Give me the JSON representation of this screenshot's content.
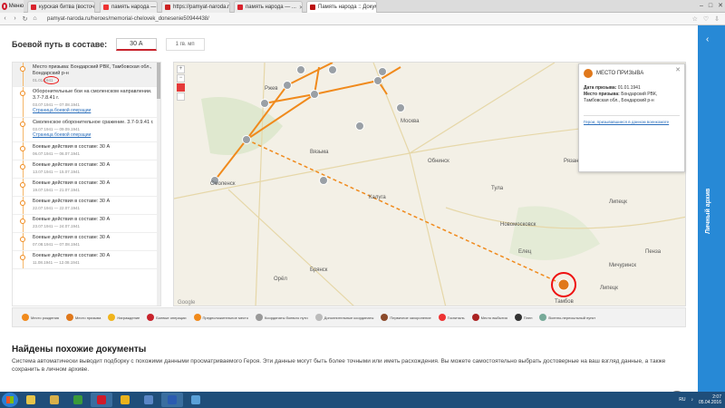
{
  "browser": {
    "menu_label": "Меню",
    "tabs": [
      {
        "label": "курская битва (восточный...",
        "color": "#d9232d"
      },
      {
        "label": "память народа — Яндекс",
        "color": "#e33"
      },
      {
        "label": "https://pamyat-naroda.ru/...",
        "color": "#cc2222"
      },
      {
        "label": "память народа — ...",
        "color": "#d9232d"
      },
      {
        "label": "Память народа :: Докум...",
        "color": "#b11",
        "active": true
      }
    ],
    "url": "pamyat-naroda.ru/heroes/memorial-chelovek_donesenie50944438/"
  },
  "page": {
    "boevoy_label": "Боевой путь в составе:",
    "army_button": "30 А",
    "guard_button": "1 гв. мп"
  },
  "timeline": [
    {
      "title": "Место призыва: Бондарский РВК, Тамбовская обл., Бондарский р-н",
      "date": "01.01.1941"
    },
    {
      "title": "Оборонительные бои на смоленском направлении. 3.7-7.8.41 г.",
      "date": "03.07.1941 — 07.08.1941",
      "link": "Страница боевой операции"
    },
    {
      "title": "Смоленское оборонительное сражение. 3.7-9.9.41 г.",
      "date": "03.07.1941 — 09.09.1941",
      "link": "Страница боевой операции"
    },
    {
      "title": "Боевые действия в составе: 30 А",
      "date": "06.07.1941 — 06.07.1941"
    },
    {
      "title": "Боевые действия в составе: 30 А",
      "date": "13.07.1941 — 15.07.1941"
    },
    {
      "title": "Боевые действия в составе: 30 А",
      "date": "19.07.1941 — 21.07.1941"
    },
    {
      "title": "Боевые действия в составе: 30 А",
      "date": "22.07.1941 — 22.07.1941"
    },
    {
      "title": "Боевые действия в составе: 30 А",
      "date": "23.07.1941 — 24.07.1941"
    },
    {
      "title": "Боевые действия в составе: 30 А",
      "date": "07.08.1941 — 07.08.1941"
    },
    {
      "title": "Боевые действия в составе: 30 А",
      "date": "11.08.1941 — 12.08.1941"
    }
  ],
  "map": {
    "cities": [
      "Москва",
      "Смоленск",
      "Калуга",
      "Тула",
      "Брянск",
      "Тамбов",
      "Рязань",
      "Ржев",
      "Вязьма",
      "Обнинск",
      "Орёл",
      "Новомосковск",
      "Мичуринск",
      "Пенза",
      "Липецк",
      "Елец",
      "Липецк"
    ],
    "attribution": "Google"
  },
  "popup": {
    "title": "МЕСТО ПРИЗЫВА",
    "date_label": "Дата призыва:",
    "date_value": "01.01.1941",
    "place_label": "Место призыва:",
    "place_value": "Бондарский РВК, Тамбовская обл., Бондарский р-н",
    "link": "Герои, призывавшиеся в данном военкомате"
  },
  "legend": [
    {
      "label": "Место рождения",
      "color": "#f08a1c"
    },
    {
      "label": "Место призыва",
      "color": "#e0781b"
    },
    {
      "label": "Награждение",
      "color": "#f0b41c"
    },
    {
      "label": "Боевые операции",
      "color": "#c8232c"
    },
    {
      "label": "Предположительное место",
      "color": "#f08a1c"
    },
    {
      "label": "Координаты боевого пути",
      "color": "#999"
    },
    {
      "label": "Дополнительные координаты",
      "color": "#bbb"
    },
    {
      "label": "Первичное захоронение",
      "color": "#8b4a2b"
    },
    {
      "label": "Госпиталь",
      "color": "#e33"
    },
    {
      "label": "Место выбытия",
      "color": "#a22"
    },
    {
      "label": "Плен",
      "color": "#333"
    },
    {
      "label": "Военно-пересыльный пункт",
      "color": "#7a9"
    }
  ],
  "similar": {
    "title": "Найдены похожие документы",
    "text": "Система автоматически выводит подборку с похожими данными просматриваемого Героя. Эти данные могут быть более точными или иметь расхождения. Вы можете самостоятельно выбрать достоверные на ваш взгляд данные, а также сохранить в личном архиве."
  },
  "side_tab": {
    "label": "Личный архив"
  },
  "taskbar": {
    "lang": "RU",
    "time": "2:07",
    "date": "05.04.2016",
    "apps": [
      {
        "name": "explorer",
        "color": "#e6c44a"
      },
      {
        "name": "folder",
        "color": "#d8b04a"
      },
      {
        "name": "media",
        "color": "#3a9a3a"
      },
      {
        "name": "opera",
        "color": "#d01a2a",
        "active": true
      },
      {
        "name": "chrome",
        "color": "#eab21c"
      },
      {
        "name": "app",
        "color": "#5a86c6"
      },
      {
        "name": "word",
        "color": "#2b5bb0",
        "active": true
      },
      {
        "name": "paint",
        "color": "#5aa0d8"
      }
    ]
  }
}
